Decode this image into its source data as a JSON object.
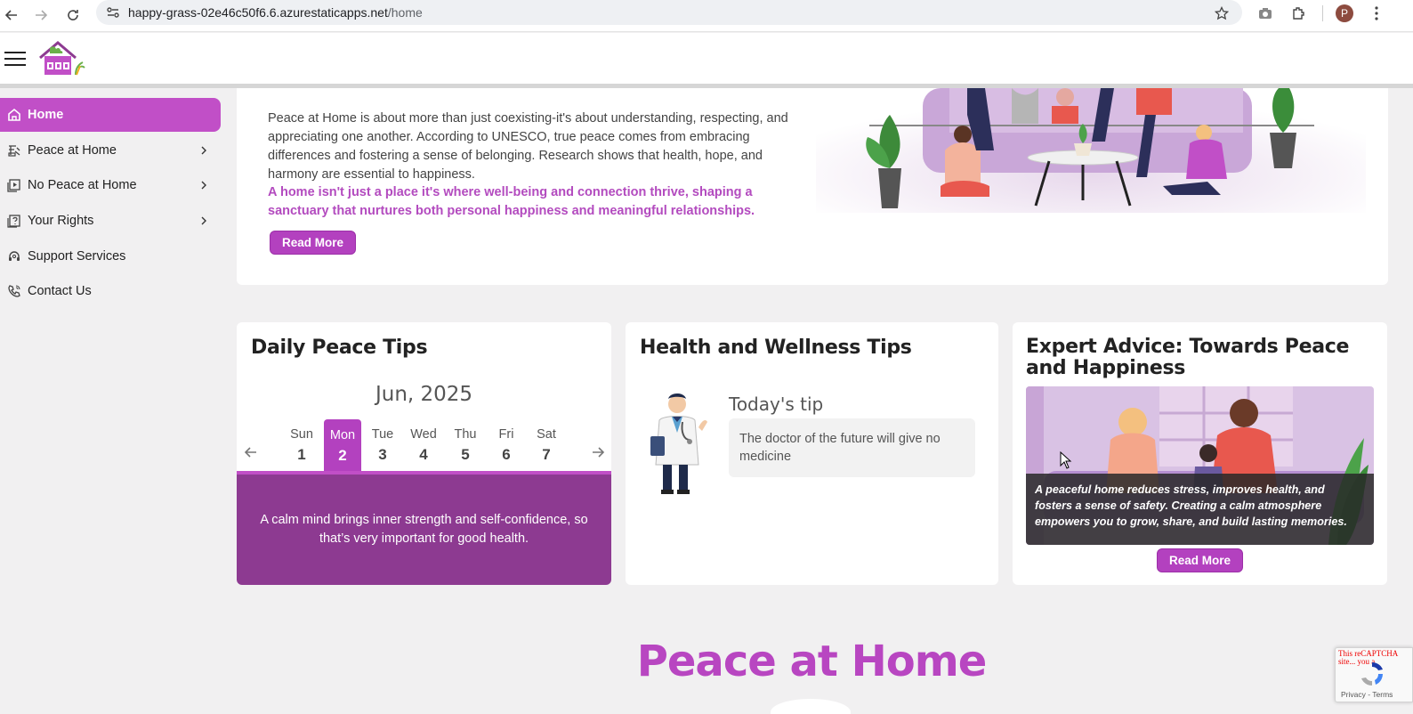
{
  "browser": {
    "url_host": "happy-grass-02e46c50f6.6.azurestaticapps.net",
    "url_path": "/home",
    "profile_initial": "P"
  },
  "sidebar": {
    "items": [
      {
        "label": "Home",
        "icon": "home-icon",
        "active": true
      },
      {
        "label": "Peace at Home",
        "icon": "peace-icon",
        "has_children": true
      },
      {
        "label": "No Peace at Home",
        "icon": "play-square-icon",
        "has_children": true
      },
      {
        "label": "Your Rights",
        "icon": "rights-icon",
        "has_children": true
      },
      {
        "label": "Support Services",
        "icon": "headset-icon"
      },
      {
        "label": "Contact Us",
        "icon": "phone-icon"
      }
    ]
  },
  "intro": {
    "text": "Peace at Home is about more than just coexisting-it's about understanding, respecting, and appreciating one another. According to UNESCO, true peace comes from embracing differences and fostering a sense of belonging. Research shows that health, hope, and harmony are essential to happiness.",
    "highlight": "A home isn't just a place it's where well-being and connection thrive, shaping a sanctuary that nurtures both personal happiness and meaningful relationships.",
    "read_more": "Read More"
  },
  "daily_tips": {
    "title": "Daily Peace Tips",
    "month": "Jun, 2025",
    "days": [
      {
        "name": "Sun",
        "num": "1"
      },
      {
        "name": "Mon",
        "num": "2",
        "selected": true
      },
      {
        "name": "Tue",
        "num": "3"
      },
      {
        "name": "Wed",
        "num": "4"
      },
      {
        "name": "Thu",
        "num": "5"
      },
      {
        "name": "Fri",
        "num": "6"
      },
      {
        "name": "Sat",
        "num": "7"
      }
    ],
    "tip": "A calm mind brings inner strength and self-confidence, so that’s very important for good health."
  },
  "health": {
    "title": "Health and Wellness Tips",
    "today_label": "Today's tip",
    "tip": "The doctor of the future will give no medicine"
  },
  "expert": {
    "title": "Expert Advice: Towards Peace and Happiness",
    "caption": "A peaceful home reduces stress, improves health, and fosters a sense of safety. Creating a calm atmosphere empowers you to grow, share, and build lasting memories.",
    "read_more": "Read More"
  },
  "section_title": "Peace at Home",
  "captcha": {
    "warning": "This reCAPTCHA site... you a",
    "terms": "Privacy - Terms"
  },
  "colors": {
    "accent": "#b341bf",
    "accent_dark": "#8d3a91",
    "page_bg": "#f1f0f1"
  }
}
